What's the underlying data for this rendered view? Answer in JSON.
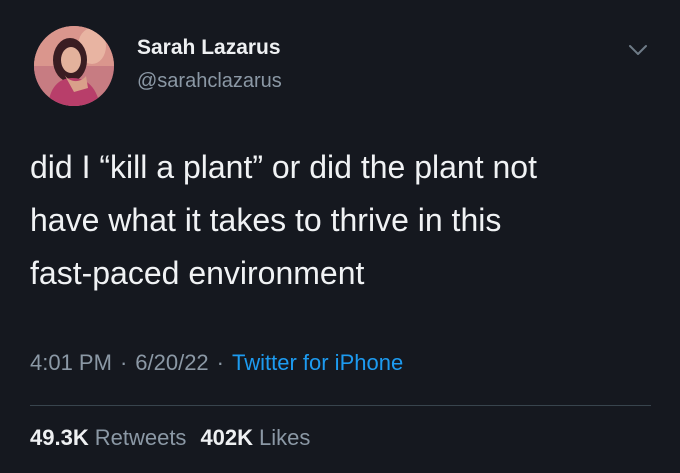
{
  "author": {
    "name": "Sarah Lazarus",
    "handle": "@sarahclazarus"
  },
  "icons": {
    "menu": "chevron-down-icon",
    "avatar": "profile-photo"
  },
  "tweet": {
    "lines": [
      "did I “kill a plant” or did the plant not",
      "have what it takes to thrive in this",
      "fast-paced environment"
    ]
  },
  "meta": {
    "time": "4:01 PM",
    "separator": "·",
    "date": "6/20/22",
    "source": "Twitter for iPhone"
  },
  "stats": {
    "retweets_count": "49.3K",
    "retweets_label": "Retweets",
    "likes_count": "402K",
    "likes_label": "Likes"
  },
  "colors": {
    "background": "#15181f",
    "link": "#1d9bf0",
    "secondary_text": "#8b98a5"
  }
}
